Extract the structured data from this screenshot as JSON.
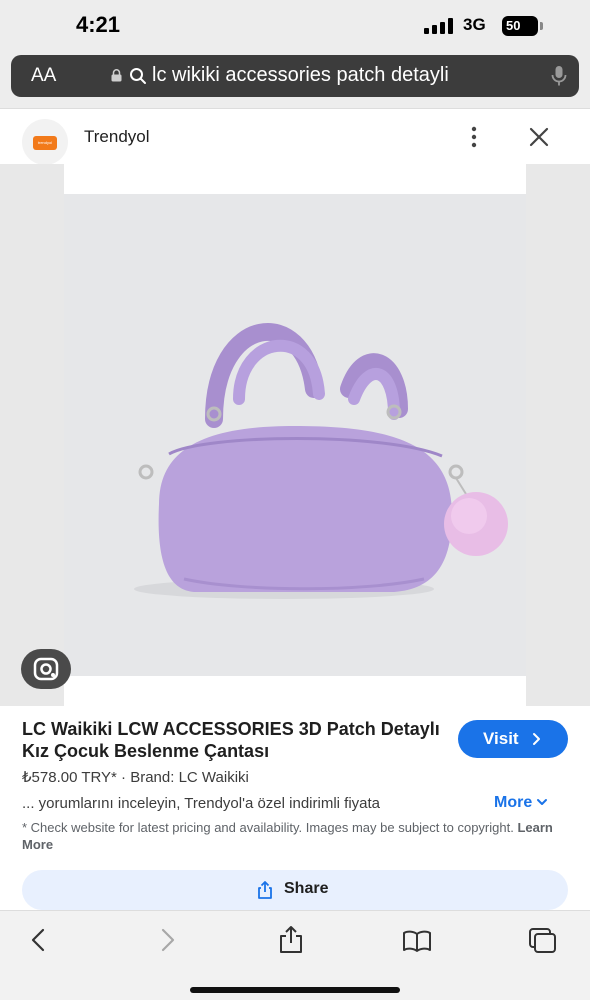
{
  "status_bar": {
    "time": "4:21",
    "network": "3G",
    "battery": "50"
  },
  "address_bar": {
    "aa_label": "AA",
    "url_text": "lc wikiki accessories patch detayli"
  },
  "site": {
    "name": "Trendyol",
    "logo_text": "trendyol",
    "brand_color": "#f27a1a"
  },
  "product": {
    "title": "LC Waikiki LCW ACCESSORIES 3D Patch Detaylı Kız Çocuk Beslenme Çantası",
    "price_line": "₺578.00 TRY* · Brand: LC Waikiki",
    "snippet": "... yorumlarını inceleyin, Trendyol'a özel indirimli fiyata",
    "more_label": "More",
    "disclaimer": "* Check website for latest pricing and availability. Images may be subject to copyright.",
    "learn_more": "Learn More",
    "bag_color": "#b9a2dc"
  },
  "actions": {
    "visit_label": "Visit",
    "share_label": "Share",
    "accent_color": "#1a73e8"
  },
  "toolbar": {
    "icons": [
      "back-icon",
      "forward-icon",
      "share-icon",
      "bookmarks-icon",
      "tabs-icon"
    ]
  }
}
